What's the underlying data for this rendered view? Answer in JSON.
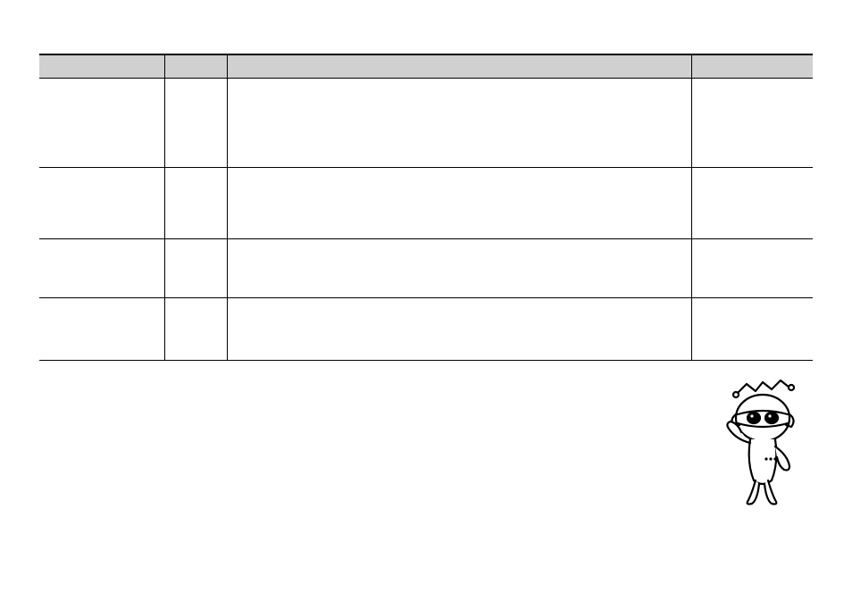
{
  "table": {
    "headers": [
      "",
      "",
      "",
      ""
    ],
    "rows": [
      [
        "",
        "",
        "",
        ""
      ],
      [
        "",
        "",
        "",
        ""
      ],
      [
        "",
        "",
        "",
        ""
      ],
      [
        "",
        "",
        "",
        ""
      ]
    ]
  }
}
